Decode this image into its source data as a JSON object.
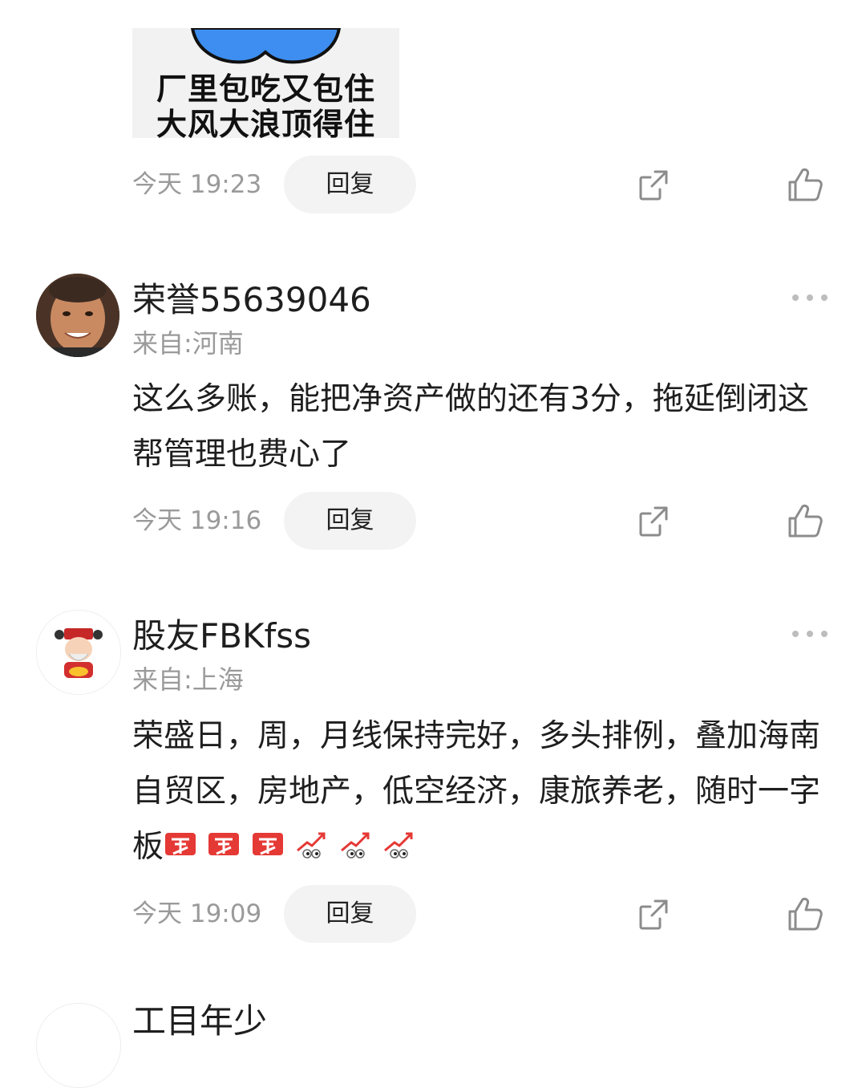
{
  "meme": {
    "line1": "厂里包吃又包住",
    "line2": "大风大浪顶得住"
  },
  "first_meta": {
    "time": "今天 19:23",
    "reply": "回复"
  },
  "comments": [
    {
      "username": "荣誉55639046",
      "location": "来自:河南",
      "text": "这么多账，能把净资产做的还有3分，拖延倒闭这帮管理也费心了",
      "time": "今天 19:16",
      "reply": "回复"
    },
    {
      "username": "股友FBKfss",
      "location": "来自:上海",
      "text": "荣盛日，周，月线保持完好，多头排例，叠加海南自贸区，房地产，低空经济，康旅养老，随时一字板",
      "time": "今天 19:09",
      "reply": "回复"
    }
  ],
  "next_comment": {
    "username": "工目年少"
  },
  "icons": {
    "share": "share-icon",
    "like": "thumbs-up-icon",
    "more": "more-dots-icon",
    "buy": "buy-sticker-icon",
    "rising": "rising-arrow-eyes-icon"
  },
  "colors": {
    "meta_gray": "#9a9a9a",
    "reply_bg": "#f3f3f3",
    "buy_red": "#e53935",
    "meme_blue": "#3d8ef0"
  }
}
